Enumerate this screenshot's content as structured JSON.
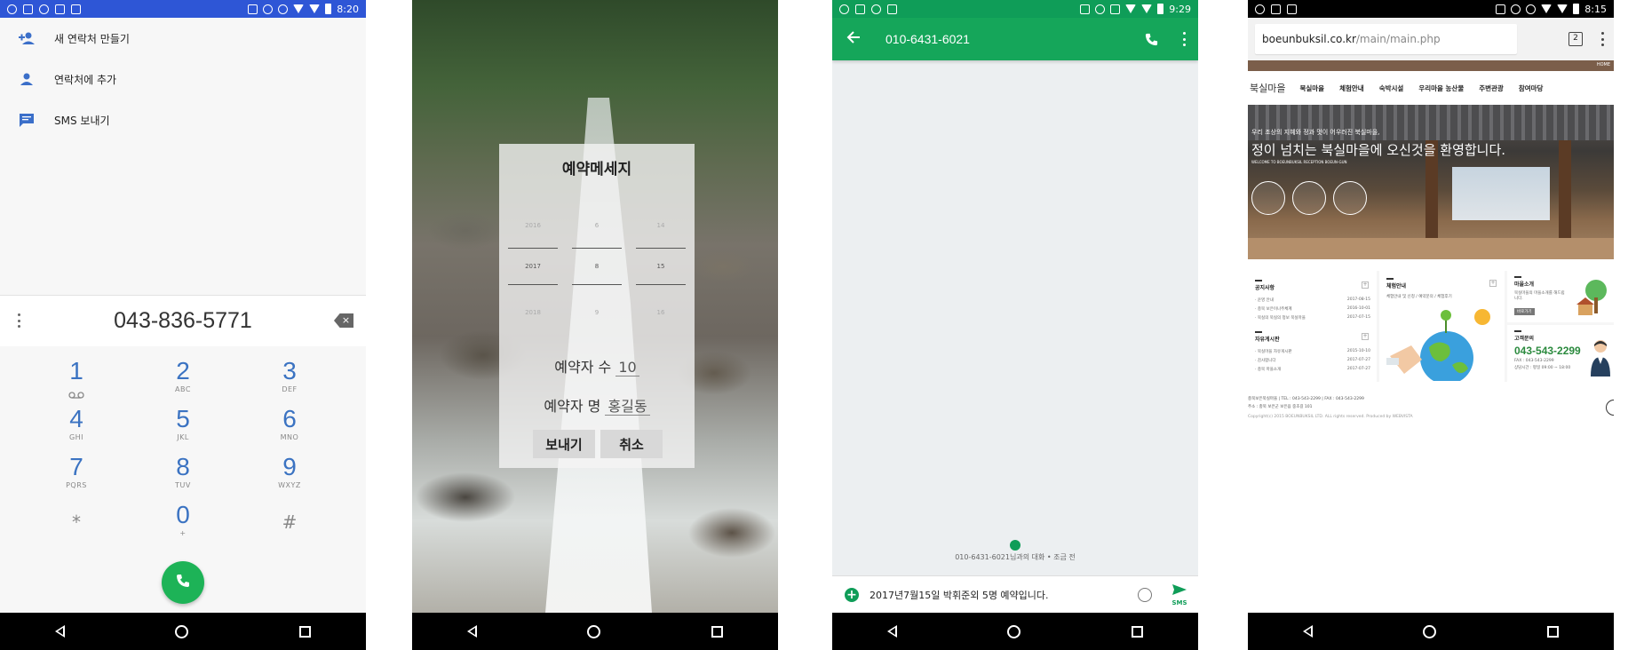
{
  "phone1": {
    "status": {
      "time": "8:20"
    },
    "menu": [
      {
        "label": "새 연락처 만들기",
        "icon": "add-contact-icon"
      },
      {
        "label": "연락처에 추가",
        "icon": "person-icon"
      },
      {
        "label": "SMS 보내기",
        "icon": "message-icon"
      }
    ],
    "dialer": {
      "number": "043-836-5771",
      "keys": [
        {
          "digit": "1",
          "letters": ""
        },
        {
          "digit": "2",
          "letters": "ABC"
        },
        {
          "digit": "3",
          "letters": "DEF"
        },
        {
          "digit": "4",
          "letters": "GHI"
        },
        {
          "digit": "5",
          "letters": "JKL"
        },
        {
          "digit": "6",
          "letters": "MNO"
        },
        {
          "digit": "7",
          "letters": "PQRS"
        },
        {
          "digit": "8",
          "letters": "TUV"
        },
        {
          "digit": "9",
          "letters": "WXYZ"
        },
        {
          "digit": "*",
          "letters": ""
        },
        {
          "digit": "0",
          "letters": "+"
        },
        {
          "digit": "#",
          "letters": ""
        }
      ]
    },
    "colors": {
      "statusbar": "#2e56d6",
      "digit": "#3b73c2",
      "call": "#1db357"
    }
  },
  "phone2": {
    "dialog": {
      "title": "예약메세지",
      "picker_prev": [
        "2016",
        "6",
        "14"
      ],
      "picker_current": [
        "2017",
        "8",
        "15"
      ],
      "picker_next": [
        "2018",
        "9",
        "16"
      ],
      "count_label": "예약자 수",
      "count_value": "10",
      "name_label": "예약자 명",
      "name_value": "홍길동",
      "send_label": "보내기",
      "cancel_label": "취소"
    }
  },
  "phone3": {
    "status": {
      "time": "9:29"
    },
    "title": "010-6431-6021",
    "conversation_note": "010-6431-6021님과의 대화 • 조금 전",
    "compose_text": "2017년7월15일 박휘준외 5명 예약입니다.",
    "send_label": "SMS",
    "colors": {
      "appbar": "#15a65a",
      "statusbar": "#0f9d58"
    }
  },
  "phone4": {
    "status": {
      "time": "8:15"
    },
    "url_host": "boeunbuksil.co.kr",
    "url_path": "/main/main.php",
    "tab_count": "2",
    "top_link": "HOME",
    "site": {
      "logo": "북실마을",
      "nav": [
        "북실마을",
        "체험안내",
        "숙박시설",
        "우리마을 농산물",
        "주변관광",
        "참여마당"
      ],
      "hero_small": "우리 조상의 지혜와 정과 멋이 어우러진 북실마을,",
      "hero_title": "정이 넘치는 북실마을에 오신것을 환영합니다.",
      "hero_tiny": "WELCOME TO BOEUNBUKSIL RECEPTION BOEUN-GUN",
      "notice_title": "공지사항",
      "notices": [
        {
          "text": "· 운영 안내",
          "date": "2017-08-15"
        },
        {
          "text": "· 충북 보은이나주체계",
          "date": "2016-10-01"
        },
        {
          "text": "· 북실의 북실의 정보 북실마을",
          "date": "2017-07-15"
        }
      ],
      "board_title": "자유게시판",
      "board": [
        {
          "text": "· 북실마을 자유게시판",
          "date": "2015-10-10"
        },
        {
          "text": "· 감사합니다",
          "date": "2017-07-27"
        },
        {
          "text": "· 충북 마을소개",
          "date": "2017-07-27"
        }
      ],
      "exp_title": "체험안내",
      "exp_sub": "체험안내 및 신청 / 예약문의 / 체험후기",
      "intro_title": "마을소개",
      "intro_text": "북실마을의 마을소개를 해드립니다.",
      "intro_btn": "바로가기",
      "support_title": "고객문의",
      "support_phone": "043-543-2299",
      "support_fax": "FAX : 043-543-2299",
      "support_hours": "상담시간 : 평일 09:00 ~ 18:00",
      "footer1": "충북보은북실마을 | TEL : 043-543-2299 | FAX : 043-543-2299",
      "footer2": "주소 : 충북 보은군 보은읍 중초길 101",
      "footer3": "Copyright(c) 2015 BOEUNBUKSIL LTD. ALL rights reserved. Produced by WEBVISTA"
    }
  }
}
